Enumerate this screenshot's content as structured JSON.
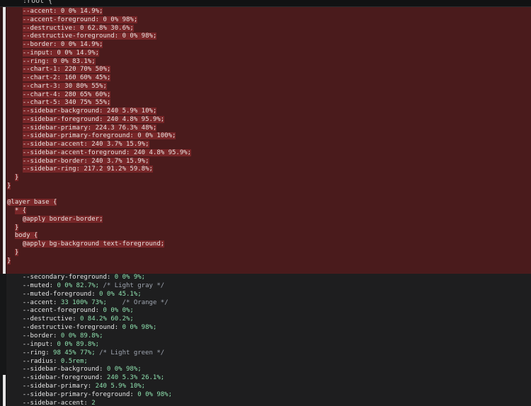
{
  "header": {
    "code": "  :root {"
  },
  "deleted_lines": [
    {
      "indent": "    ",
      "text": "--accent: 0 0% 14.9%;"
    },
    {
      "indent": "    ",
      "text": "--accent-foreground: 0 0% 98%;"
    },
    {
      "indent": "    ",
      "text": "--destructive: 0 62.8% 30.6%;"
    },
    {
      "indent": "    ",
      "text": "--destructive-foreground: 0 0% 98%;"
    },
    {
      "indent": "    ",
      "text": "--border: 0 0% 14.9%;"
    },
    {
      "indent": "    ",
      "text": "--input: 0 0% 14.9%;"
    },
    {
      "indent": "    ",
      "text": "--ring: 0 0% 83.1%;"
    },
    {
      "indent": "    ",
      "text": "--chart-1: 220 70% 50%;"
    },
    {
      "indent": "    ",
      "text": "--chart-2: 160 60% 45%;"
    },
    {
      "indent": "    ",
      "text": "--chart-3: 30 80% 55%;"
    },
    {
      "indent": "    ",
      "text": "--chart-4: 280 65% 60%;"
    },
    {
      "indent": "    ",
      "text": "--chart-5: 340 75% 55%;"
    },
    {
      "indent": "    ",
      "text": "--sidebar-background: 240 5.9% 10%;"
    },
    {
      "indent": "    ",
      "text": "--sidebar-foreground: 240 4.8% 95.9%;"
    },
    {
      "indent": "    ",
      "text": "--sidebar-primary: 224.3 76.3% 48%;"
    },
    {
      "indent": "    ",
      "text": "--sidebar-primary-foreground: 0 0% 100%;"
    },
    {
      "indent": "    ",
      "text": "--sidebar-accent: 240 3.7% 15.9%;"
    },
    {
      "indent": "    ",
      "text": "--sidebar-accent-foreground: 240 4.8% 95.9%;"
    },
    {
      "indent": "    ",
      "text": "--sidebar-border: 240 3.7% 15.9%;"
    },
    {
      "indent": "    ",
      "text": "--sidebar-ring: 217.2 91.2% 59.8%;"
    },
    {
      "indent": "  ",
      "text": "}"
    },
    {
      "indent": "",
      "text": "}"
    },
    {
      "indent": "",
      "text": ""
    },
    {
      "indent": "",
      "text": "@layer base {"
    },
    {
      "indent": "  ",
      "text": "* {"
    },
    {
      "indent": "    ",
      "text": "@apply border-border;"
    },
    {
      "indent": "  ",
      "text": "}"
    },
    {
      "indent": "  ",
      "text": "body {"
    },
    {
      "indent": "    ",
      "text": "@apply bg-background text-foreground;"
    },
    {
      "indent": "  ",
      "text": "}"
    },
    {
      "indent": "",
      "text": "}"
    }
  ],
  "added_lines": [
    {
      "name": "--secondary-foreground:",
      "value": " 0 0% 9%;",
      "comment": ""
    },
    {
      "name": "--muted:",
      "value": " 0 0% 82.7%;",
      "comment": " /* Light gray */"
    },
    {
      "name": "--muted-foreground:",
      "value": " 0 0% 45.1%;",
      "comment": ""
    },
    {
      "name": "--accent:",
      "value": " 33 100% 73%;",
      "comment": "    /* Orange */"
    },
    {
      "name": "--accent-foreground:",
      "value": " 0 0% 0%;",
      "comment": ""
    },
    {
      "name": "--destructive:",
      "value": " 0 84.2% 60.2%;",
      "comment": ""
    },
    {
      "name": "--destructive-foreground:",
      "value": " 0 0% 98%;",
      "comment": ""
    },
    {
      "name": "--border:",
      "value": " 0 0% 89.8%;",
      "comment": ""
    },
    {
      "name": "--input:",
      "value": " 0 0% 89.8%;",
      "comment": ""
    },
    {
      "name": "--ring:",
      "value": " 98 45% 77%;",
      "comment": " /* Light green */"
    },
    {
      "name": "--radius:",
      "value": " 0.5rem;",
      "comment": ""
    },
    {
      "name": "--sidebar-background:",
      "value": " 0 0% 98%;",
      "comment": ""
    },
    {
      "name": "--sidebar-foreground:",
      "value": " 240 5.3% 26.1%;",
      "comment": ""
    },
    {
      "name": "--sidebar-primary:",
      "value": " 240 5.9% 10%;",
      "comment": ""
    },
    {
      "name": "--sidebar-primary-foreground:",
      "value": " 0 0% 98%;",
      "comment": ""
    },
    {
      "name": "--sidebar-accent:",
      "value": " 2",
      "comment": ""
    }
  ],
  "colors": {
    "deleted_background": "#4a1b1c",
    "deleted_highlight": "#782628",
    "added_value": "#8ee0ae",
    "comment": "#9fa5b0",
    "keyword": "#c9a4ff"
  }
}
